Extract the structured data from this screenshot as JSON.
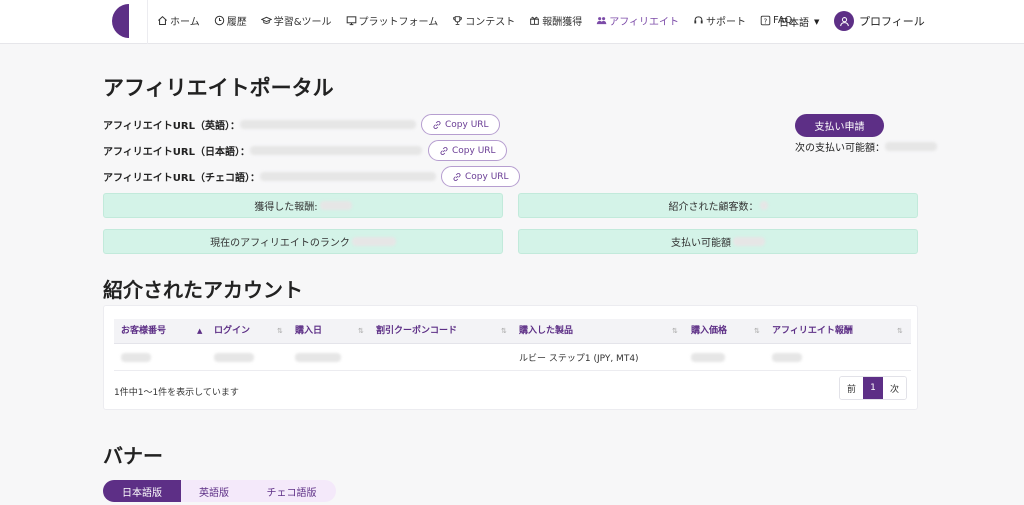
{
  "nav": {
    "items": [
      {
        "label": "ホーム",
        "icon": "home-icon"
      },
      {
        "label": "履歴",
        "icon": "clock-icon"
      },
      {
        "label": "学習&ツール",
        "icon": "graduation-cap-icon"
      },
      {
        "label": "プラットフォーム",
        "icon": "monitor-icon"
      },
      {
        "label": "コンテスト",
        "icon": "trophy-icon"
      },
      {
        "label": "報酬獲得",
        "icon": "gift-icon"
      },
      {
        "label": "アフィリエイト",
        "icon": "users-icon",
        "active": true
      },
      {
        "label": "サポート",
        "icon": "headset-icon"
      },
      {
        "label": "FAQ",
        "icon": "question-icon"
      }
    ],
    "language": "日本語",
    "profile": "プロフィール"
  },
  "portal": {
    "title": "アフィリエイトポータル",
    "url_en_label": "アフィリエイトURL（英語）：",
    "url_ja_label": "アフィリエイトURL（日本語）：",
    "url_cs_label": "アフィリエイトURL（チェコ語）：",
    "copy_label": "Copy URL",
    "pay_button": "支払い申請",
    "next_payment_label": "次の支払い可能額："
  },
  "stats": {
    "earned": "獲得した報酬:",
    "referred_customers": "紹介された顧客数：",
    "rank": "現在のアフィリエイトのランク",
    "payable": "支払い可能額"
  },
  "accounts": {
    "title": "紹介されたアカウント",
    "columns": [
      "お客様番号",
      "ログイン",
      "購入日",
      "割引クーポンコード",
      "購入した製品",
      "購入価格",
      "アフィリエイト報酬"
    ],
    "rows": [
      {
        "product": "ルビー ステップ1 (JPY, MT4)"
      }
    ],
    "info": "1件中1～1件を表示しています",
    "prev": "前",
    "page": "1",
    "next": "次"
  },
  "banner": {
    "title": "バナー",
    "tabs": [
      "日本語版",
      "英語版",
      "チェコ語版"
    ]
  },
  "colors": {
    "brand": "#5d2f86",
    "stat_bg": "#d4f3e8"
  }
}
